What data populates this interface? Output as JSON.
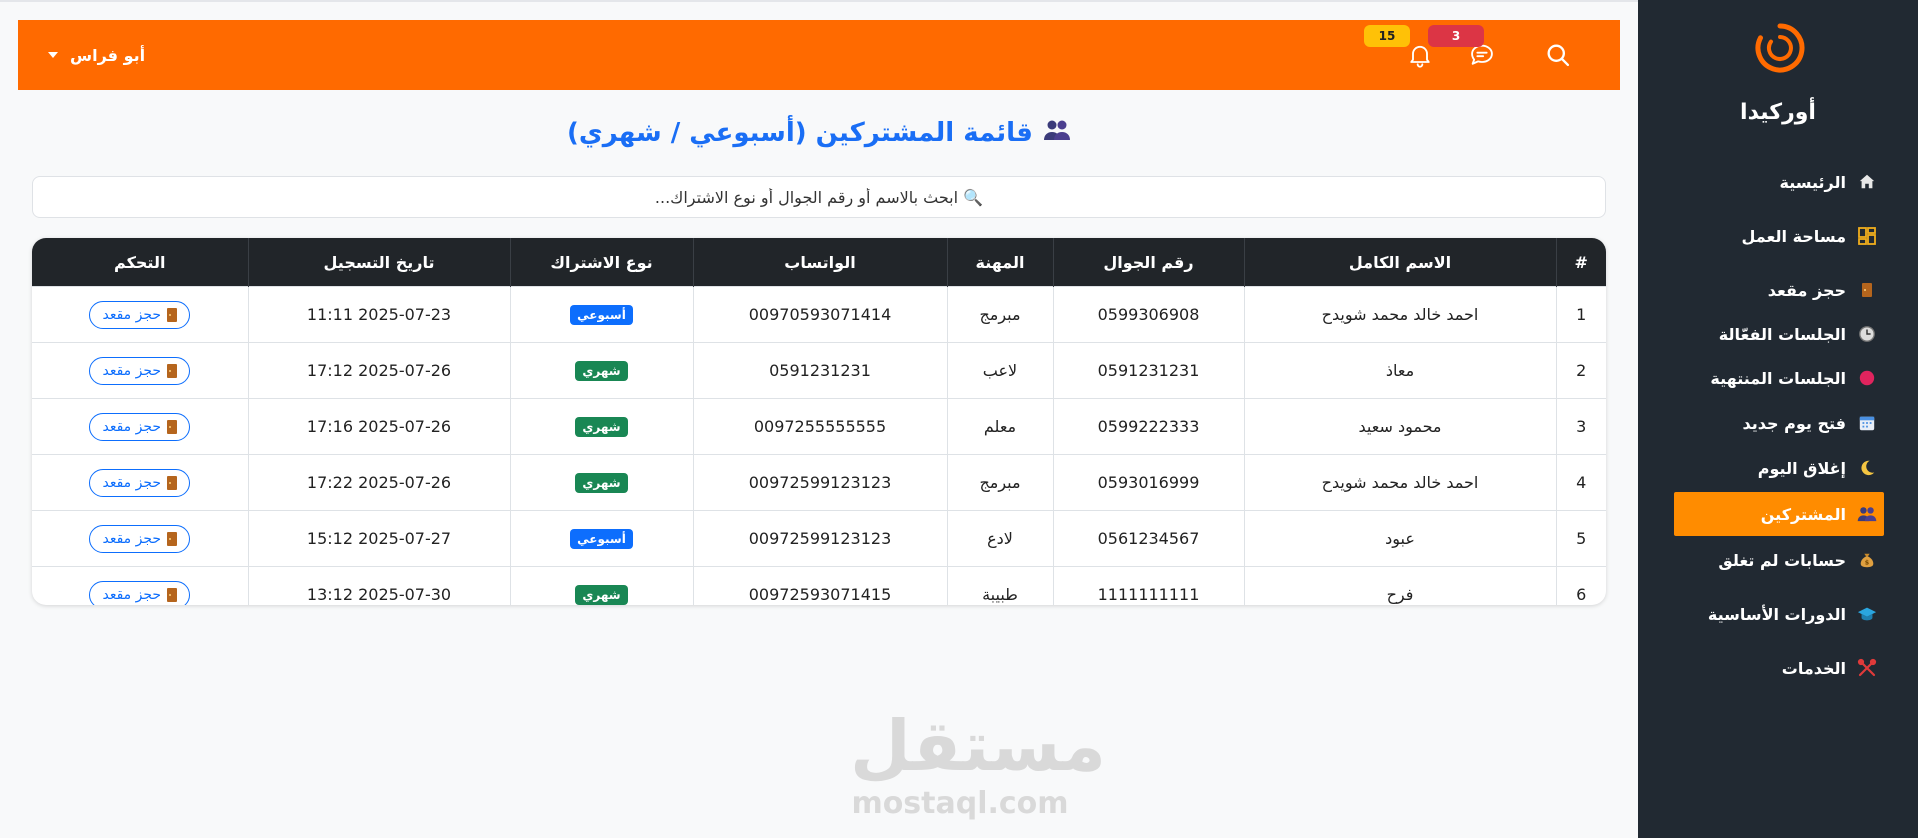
{
  "header": {
    "user_name": "أبو فراس",
    "notifications_count": "15",
    "messages_count": "3"
  },
  "sidebar": {
    "brand": "أوركيدا",
    "items": [
      {
        "label": "الرئيسية",
        "icon": "home-icon"
      },
      {
        "label": "مساحة العمل",
        "icon": "dashboard-icon"
      },
      {
        "label": "حجز مقعد",
        "icon": "door-icon"
      },
      {
        "label": "الجلسات الفعّالة",
        "icon": "clock-icon"
      },
      {
        "label": "الجلسات المنتهية",
        "icon": "red-circle-icon"
      },
      {
        "label": "فتح يوم جديد",
        "icon": "calendar-icon"
      },
      {
        "label": "إغلاق اليوم",
        "icon": "moon-icon"
      },
      {
        "label": "المشتركين",
        "icon": "users-icon"
      },
      {
        "label": "حسابات لم تغلق",
        "icon": "money-bag-icon"
      },
      {
        "label": "الدورات الأساسية",
        "icon": "graduation-cap-icon"
      },
      {
        "label": "الخدمات",
        "icon": "tools-icon"
      }
    ]
  },
  "page": {
    "title": "قائمة المشتركين (أسبوعي / شهري)",
    "search_placeholder": "🔍 ابحث بالاسم أو رقم الجوال أو نوع الاشتراك..."
  },
  "table": {
    "headers": [
      "#",
      "الاسم الكامل",
      "رقم الجوال",
      "المهنة",
      "الواتساب",
      "نوع الاشتراك",
      "تاريخ التسجيل",
      "التحكم"
    ],
    "rows": [
      {
        "num": "1",
        "name": "احمد خالد محمد شويدح",
        "phone": "0599306908",
        "job": "مبرمج",
        "whatsapp": "00970593071414",
        "type": "أسبوعي",
        "date": "2025-07-23 11:11",
        "action": "حجز مقعد"
      },
      {
        "num": "2",
        "name": "معاذ",
        "phone": "0591231231",
        "job": "لاعب",
        "whatsapp": "0591231231",
        "type": "شهري",
        "date": "2025-07-26 17:12",
        "action": "حجز مقعد"
      },
      {
        "num": "3",
        "name": "محمود سعيد",
        "phone": "0599222333",
        "job": "معلم",
        "whatsapp": "0097255555555",
        "type": "شهري",
        "date": "2025-07-26 17:16",
        "action": "حجز مقعد"
      },
      {
        "num": "4",
        "name": "احمد خالد محمد شويدح",
        "phone": "0593016999",
        "job": "مبرمج",
        "whatsapp": "00972599123123",
        "type": "شهري",
        "date": "2025-07-26 17:22",
        "action": "حجز مقعد"
      },
      {
        "num": "5",
        "name": "عبود",
        "phone": "0561234567",
        "job": "لادع",
        "whatsapp": "00972599123123",
        "type": "أسبوعي",
        "date": "2025-07-27 15:12",
        "action": "حجز مقعد"
      },
      {
        "num": "6",
        "name": "فرح",
        "phone": "1111111111",
        "job": "طبيبة",
        "whatsapp": "00972593071415",
        "type": "شهري",
        "date": "2025-07-30 13:12",
        "action": "حجز مقعد"
      }
    ]
  },
  "colors": {
    "header": "#ff6a00",
    "sidebar": "#212932",
    "active_item": "#ff8c00",
    "weekly_badge": "#0d6efd",
    "monthly_badge": "#198754",
    "title": "#1a6ef5"
  },
  "watermark": {
    "arabic": "مستقل",
    "latin": "mostaql.com"
  }
}
